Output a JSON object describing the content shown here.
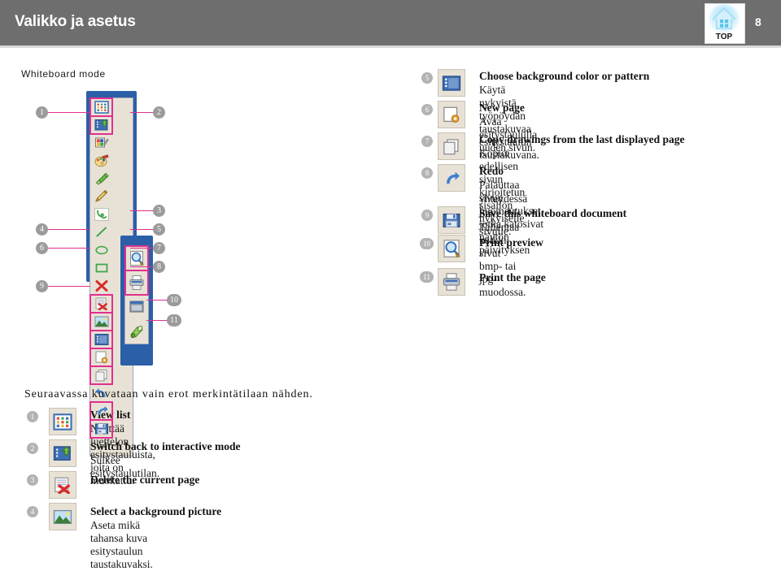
{
  "header": {
    "title": "Valikko ja asetus",
    "page_number": "8",
    "logo_label": "TOP",
    "bg_color": "#6e6e6e"
  },
  "section": {
    "label": "Whiteboard mode"
  },
  "toolbar": {
    "name": "whiteboard-toolbar",
    "frame_color": "#2b5fa8",
    "highlight_color": "#e0308e",
    "main_buttons": [
      {
        "n": 1,
        "icon": "view-list-icon",
        "highlighted": true
      },
      {
        "n": 2,
        "icon": "switch-back-icon",
        "highlighted": true
      },
      {
        "n": 0,
        "icon": "pen-settings-icon",
        "highlighted": false
      },
      {
        "n": 0,
        "icon": "color-palette-icon",
        "highlighted": false
      },
      {
        "n": 0,
        "icon": "highlighter-icon",
        "highlighted": false
      },
      {
        "n": 0,
        "icon": "pencil-icon",
        "highlighted": false
      },
      {
        "n": 0,
        "icon": "freehand-icon",
        "highlighted": false
      },
      {
        "n": 0,
        "icon": "straight-line-icon",
        "highlighted": false
      },
      {
        "n": 0,
        "icon": "ellipse-icon",
        "highlighted": false
      },
      {
        "n": 0,
        "icon": "rectangle-icon",
        "highlighted": false
      },
      {
        "n": 0,
        "icon": "eraser-x-icon",
        "highlighted": false
      },
      {
        "n": 3,
        "icon": "delete-page-icon",
        "highlighted": true
      },
      {
        "n": 4,
        "icon": "background-picture-icon",
        "highlighted": true
      },
      {
        "n": 5,
        "icon": "background-color-icon",
        "highlighted": true
      },
      {
        "n": 6,
        "icon": "new-page-icon",
        "highlighted": true
      },
      {
        "n": 7,
        "icon": "copy-drawings-icon",
        "highlighted": true
      },
      {
        "n": 0,
        "icon": "undo-icon",
        "highlighted": false
      },
      {
        "n": 8,
        "icon": "redo-icon",
        "highlighted": true
      },
      {
        "n": 9,
        "icon": "save-icon",
        "highlighted": true
      },
      {
        "n": 0,
        "icon": "more-options-icon",
        "highlighted": false
      }
    ],
    "sub_buttons": [
      {
        "n": 10,
        "icon": "print-preview-icon",
        "highlighted": true
      },
      {
        "n": 11,
        "icon": "print-icon",
        "highlighted": true
      },
      {
        "n": 0,
        "icon": "screen-capture-icon",
        "highlighted": false
      },
      {
        "n": 0,
        "icon": "spotlight-icon",
        "highlighted": false
      }
    ],
    "callouts_left": [
      "1",
      "4",
      "6",
      "9"
    ],
    "callouts_right": [
      "2",
      "3",
      "5",
      "7",
      "8",
      "10",
      "11"
    ]
  },
  "descriptions_upper": [
    {
      "num": "5",
      "icon": "background-color-icon",
      "title": "Choose background color or pattern",
      "body": "Käytä nykyistä työpöydän taustakuvaa esitystaulun taustakuvana."
    },
    {
      "num": "6",
      "icon": "new-page-icon",
      "title": "New page",
      "body": "Avaa esitystaululla uuden sivun."
    },
    {
      "num": "7",
      "icon": "copy-drawings-icon",
      "title": "Copy drawings from the last displayed page",
      "body": "Kopioi edellisen sivun kirjoitetun sisällön nykyiselle sivulle."
    },
    {
      "num": "8",
      "icon": "redo-icon",
      "title": "Redo",
      "body": "Palauttaa sivun huomautukset, jotka katosivat näytön päivityksen",
      "body2": "yhteydessä jne."
    },
    {
      "num": "9",
      "icon": "save-icon",
      "title": "Save this whiteboard document",
      "body": "Tallentaa kaikki sivut bmp- tai jpg-muodossa."
    },
    {
      "num": "10",
      "icon": "print-preview-icon",
      "title": "Print preview",
      "body": ""
    },
    {
      "num": "11",
      "icon": "print-icon",
      "title": "Print the page",
      "body": ""
    }
  ],
  "bottom": {
    "intro": "Seuraavassa kuvataan vain erot merkintätilaan nähden.",
    "descriptions": [
      {
        "num": "1",
        "icon": "view-list-icon",
        "title": "View list",
        "body": "Näyttää luettelon esitystauluista, joita on muokattu."
      },
      {
        "num": "2",
        "icon": "switch-back-icon",
        "title": "Switch back to interactive mode",
        "body": "Sulkee esitystaulutilan."
      },
      {
        "num": "3",
        "icon": "delete-page-icon",
        "title": "Delete the current page",
        "body": ""
      },
      {
        "num": "4",
        "icon": "background-picture-icon",
        "title": "Select a background picture",
        "body": "Aseta mikä tahansa kuva esitystaulun taustakuvaksi."
      }
    ]
  }
}
